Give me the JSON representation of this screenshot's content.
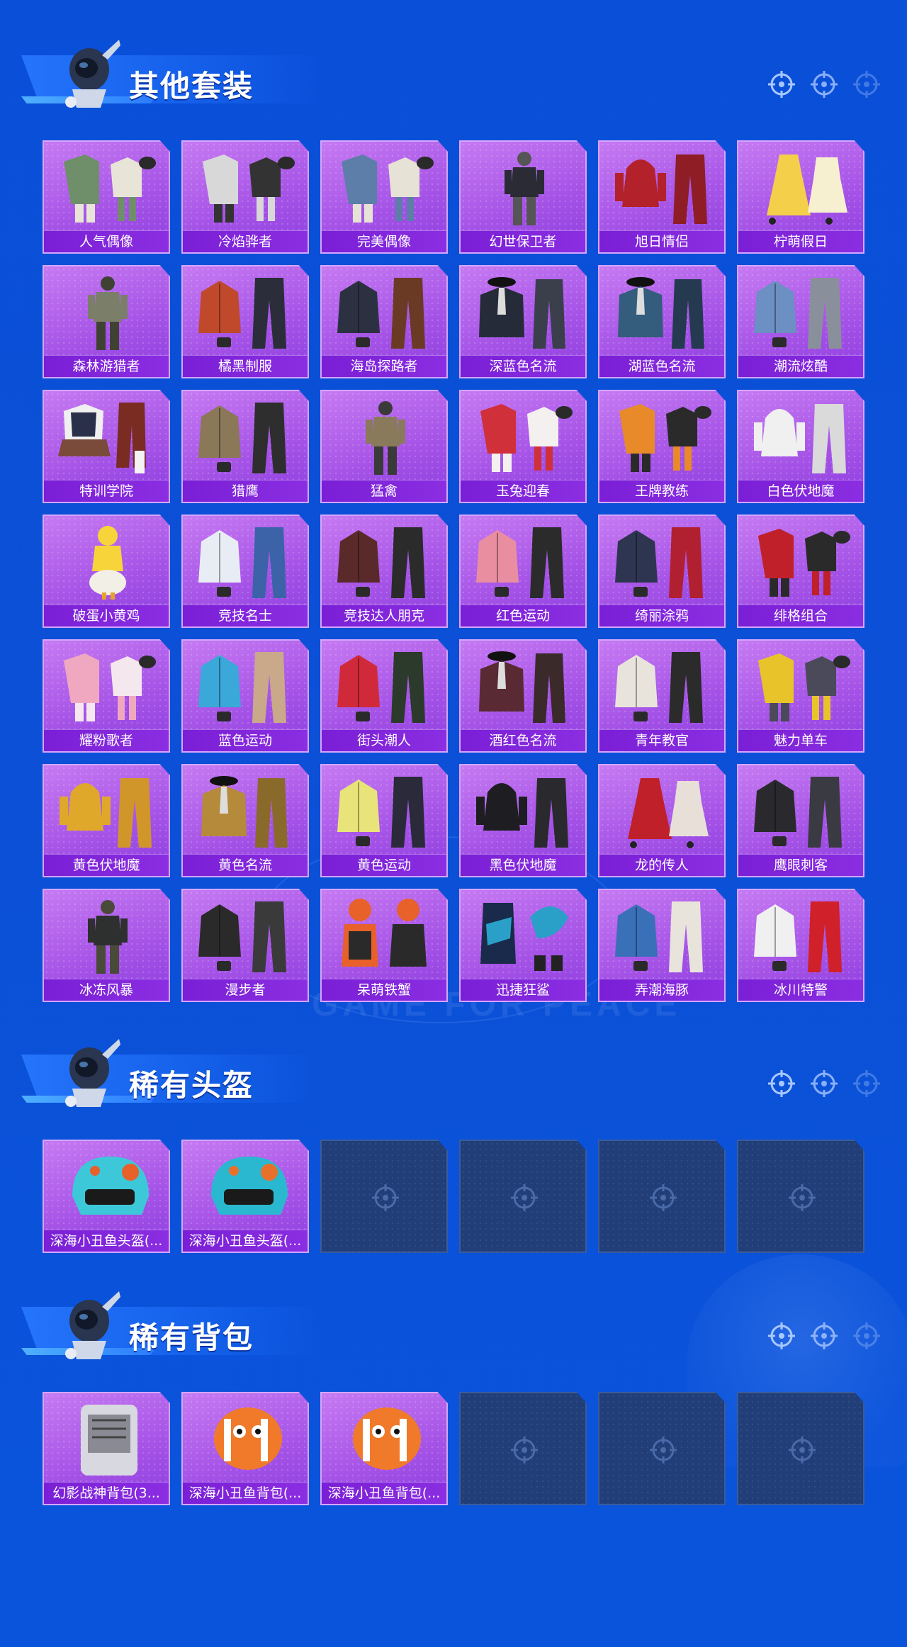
{
  "sections": [
    {
      "title": "其他套装",
      "items": [
        {
          "label": "人气偶像",
          "art": "outfit-set",
          "c1": "#6f8f6a",
          "c2": "#e8e4d8"
        },
        {
          "label": "冷焰骅者",
          "art": "outfit-set",
          "c1": "#d8d8d8",
          "c2": "#333"
        },
        {
          "label": "完美偶像",
          "art": "outfit-set",
          "c1": "#5d7ea8",
          "c2": "#e6e2d5"
        },
        {
          "label": "幻世保卫者",
          "art": "figure",
          "c1": "#2b2b35",
          "c2": "#555"
        },
        {
          "label": "旭日情侣",
          "art": "hoodie-pants",
          "c1": "#b3222a",
          "c2": "#8f1d26"
        },
        {
          "label": "柠萌假日",
          "art": "dress",
          "c1": "#f4d04a",
          "c2": "#f7f0d0"
        },
        {
          "label": "森林游猎者",
          "art": "figure",
          "c1": "#7b7f6a",
          "c2": "#3f4233"
        },
        {
          "label": "橘黑制服",
          "art": "jacket-pants",
          "c1": "#c0492b",
          "c2": "#2b2e3a"
        },
        {
          "label": "海岛探路者",
          "art": "jacket-pants",
          "c1": "#2c3142",
          "c2": "#6b3a25"
        },
        {
          "label": "深蓝色名流",
          "art": "suit",
          "c1": "#262b3a",
          "c2": "#3b3f4c"
        },
        {
          "label": "湖蓝色名流",
          "art": "suit",
          "c1": "#345c7c",
          "c2": "#253a50"
        },
        {
          "label": "潮流炫酷",
          "art": "jacket-pants",
          "c1": "#6c8fc4",
          "c2": "#8a8f9c"
        },
        {
          "label": "特训学院",
          "art": "uniform",
          "c1": "#2a2f4a",
          "c2": "#7a2b22"
        },
        {
          "label": "猎鹰",
          "art": "jacket-pants",
          "c1": "#8a7858",
          "c2": "#2e2e2e"
        },
        {
          "label": "猛禽",
          "art": "figure",
          "c1": "#8a7a5c",
          "c2": "#3a3a3a"
        },
        {
          "label": "玉兔迎春",
          "art": "outfit-set",
          "c1": "#d0303a",
          "c2": "#f4f0f0"
        },
        {
          "label": "王牌教练",
          "art": "outfit-set",
          "c1": "#e88a2a",
          "c2": "#2a2a2a"
        },
        {
          "label": "白色伏地魔",
          "art": "hoodie-pants",
          "c1": "#f0f0f0",
          "c2": "#dadada"
        },
        {
          "label": "破蛋小黄鸡",
          "art": "chick",
          "c1": "#f6d43a",
          "c2": "#f2efe6"
        },
        {
          "label": "竞技名士",
          "art": "jacket-pants",
          "c1": "#e8ecf4",
          "c2": "#3c62a8"
        },
        {
          "label": "竞技达人朋克",
          "art": "jacket-pants",
          "c1": "#5a2a2a",
          "c2": "#2b2b2b"
        },
        {
          "label": "红色运动",
          "art": "jacket-pants",
          "c1": "#e88ea0",
          "c2": "#2b2b2b"
        },
        {
          "label": "绮丽涂鸦",
          "art": "jacket-pants",
          "c1": "#2e3550",
          "c2": "#b02030"
        },
        {
          "label": "绯格组合",
          "art": "outfit-set",
          "c1": "#c0202a",
          "c2": "#2a2a2a"
        },
        {
          "label": "耀粉歌者",
          "art": "outfit-set",
          "c1": "#f0a8c0",
          "c2": "#f4e8ee"
        },
        {
          "label": "蓝色运动",
          "art": "jacket-pants",
          "c1": "#3aa8d8",
          "c2": "#c9a98a"
        },
        {
          "label": "街头潮人",
          "art": "jacket-pants",
          "c1": "#d02a3a",
          "c2": "#2b3a2b"
        },
        {
          "label": "酒红色名流",
          "art": "suit",
          "c1": "#5a2a34",
          "c2": "#3a2a2a"
        },
        {
          "label": "青年教官",
          "art": "jacket-pants",
          "c1": "#e8e4dc",
          "c2": "#2b2b2b"
        },
        {
          "label": "魅力单车",
          "art": "outfit-set",
          "c1": "#e8c42a",
          "c2": "#4a4a5a"
        },
        {
          "label": "黄色伏地魔",
          "art": "hoodie-pants",
          "c1": "#e0a82a",
          "c2": "#d0962a"
        },
        {
          "label": "黄色名流",
          "art": "suit",
          "c1": "#b58a3a",
          "c2": "#8a6a2a"
        },
        {
          "label": "黄色运动",
          "art": "jacket-pants",
          "c1": "#e8e47a",
          "c2": "#2a2a3a"
        },
        {
          "label": "黑色伏地魔",
          "art": "hoodie-pants",
          "c1": "#1e1e22",
          "c2": "#2a2a2e"
        },
        {
          "label": "龙的传人",
          "art": "dress",
          "c1": "#c0202a",
          "c2": "#e8e0d8"
        },
        {
          "label": "鹰眼刺客",
          "art": "jacket-pants",
          "c1": "#2a2a2e",
          "c2": "#3a3a42"
        },
        {
          "label": "冰冻风暴",
          "art": "figure",
          "c1": "#2e3030",
          "c2": "#4a4a3a"
        },
        {
          "label": "漫步者",
          "art": "jacket-pants",
          "c1": "#2a2a2a",
          "c2": "#3a3a3a"
        },
        {
          "label": "呆萌铁蟹",
          "art": "crab",
          "c1": "#e8602a",
          "c2": "#2a2a2a"
        },
        {
          "label": "迅捷狂鲨",
          "art": "shark",
          "c1": "#2aa0c8",
          "c2": "#1a2a4a"
        },
        {
          "label": "弄潮海豚",
          "art": "jacket-pants",
          "c1": "#3a70b8",
          "c2": "#e8e4dc"
        },
        {
          "label": "冰川特警",
          "art": "jacket-pants",
          "c1": "#f0f0f0",
          "c2": "#d0202a"
        }
      ],
      "empty_slots": 0
    },
    {
      "title": "稀有头盔",
      "items": [
        {
          "label": "深海小丑鱼头盔(...",
          "art": "helmet",
          "c1": "#3cc8d8",
          "c2": "#e8602a"
        },
        {
          "label": "深海小丑鱼头盔(...",
          "art": "helmet",
          "c1": "#2ab8d0",
          "c2": "#e8702a"
        }
      ],
      "empty_slots": 4
    },
    {
      "title": "稀有背包",
      "items": [
        {
          "label": "幻影战神背包(3...",
          "art": "backpack",
          "c1": "#d8d8e0",
          "c2": "#8a8a94"
        },
        {
          "label": "深海小丑鱼背包(...",
          "art": "fish",
          "c1": "#f07a2a",
          "c2": "#ffffff"
        },
        {
          "label": "深海小丑鱼背包(...",
          "art": "fish",
          "c1": "#f07a2a",
          "c2": "#ffffff"
        }
      ],
      "empty_slots": 3
    }
  ],
  "watermark": "GAME FOR PEACE"
}
